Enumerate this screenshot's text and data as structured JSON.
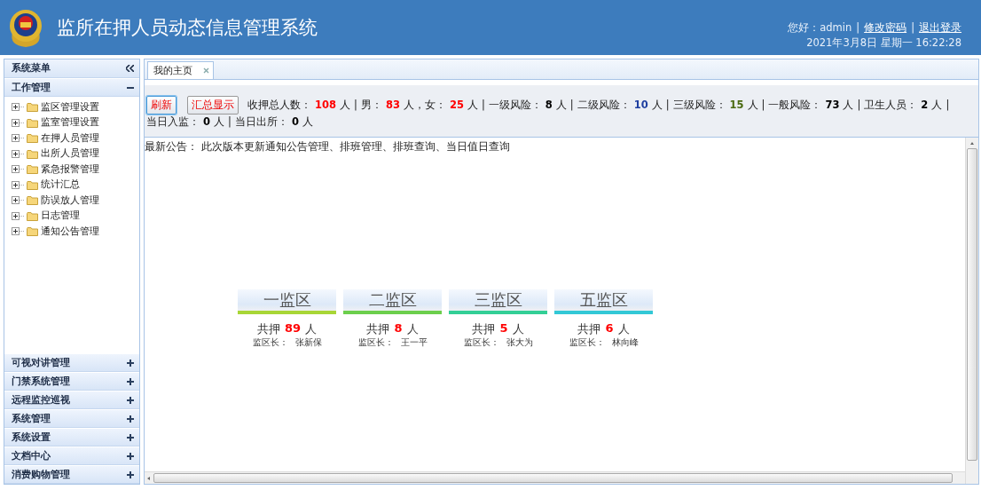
{
  "header": {
    "title": "监所在押人员动态信息管理系统",
    "user_bar": [
      {
        "kind": "text",
        "text": "您好：admin"
      },
      {
        "kind": "sep",
        "text": "|"
      },
      {
        "kind": "link",
        "text": "修改密码"
      },
      {
        "kind": "sep",
        "text": "|"
      },
      {
        "kind": "link",
        "text": "退出登录"
      }
    ],
    "datetime": "2021年3月8日 星期一 16:22:28"
  },
  "sidebar": {
    "title": "系统菜单",
    "sections": [
      {
        "title": "工作管理",
        "expanded": true,
        "items": [
          "监区管理设置",
          "监室管理设置",
          "在押人员管理",
          "出所人员管理",
          "紧急报警管理",
          "统计汇总",
          "防误放人管理",
          "日志管理",
          "通知公告管理"
        ]
      },
      {
        "title": "可视对讲管理",
        "expanded": false
      },
      {
        "title": "门禁系统管理",
        "expanded": false
      },
      {
        "title": "远程监控巡视",
        "expanded": false
      },
      {
        "title": "系统管理",
        "expanded": false
      },
      {
        "title": "系统设置",
        "expanded": false
      },
      {
        "title": "文档中心",
        "expanded": false
      },
      {
        "title": "消费购物管理",
        "expanded": false
      }
    ]
  },
  "tabs": [
    {
      "label": "我的主页",
      "selected": true
    }
  ],
  "toolbar": {
    "buttons": [
      {
        "label": "刷新",
        "kind": "primary"
      },
      {
        "label": "汇总显示",
        "kind": "plain"
      }
    ],
    "stats": [
      {
        "kind": "text",
        "text": "收押总人数："
      },
      {
        "kind": "value",
        "text": "108",
        "color": "#ff0000"
      },
      {
        "kind": "text",
        "text": "人"
      },
      {
        "kind": "sep",
        "text": "|"
      },
      {
        "kind": "text",
        "text": "男："
      },
      {
        "kind": "value",
        "text": "83",
        "color": "#ff0000"
      },
      {
        "kind": "text",
        "text": "人，女："
      },
      {
        "kind": "value",
        "text": "25",
        "color": "#ff0000"
      },
      {
        "kind": "text",
        "text": "人"
      },
      {
        "kind": "sep",
        "text": "|"
      },
      {
        "kind": "text",
        "text": "一级风险："
      },
      {
        "kind": "value",
        "text": "8",
        "color": "#000000"
      },
      {
        "kind": "text",
        "text": "人"
      },
      {
        "kind": "sep",
        "text": "|"
      },
      {
        "kind": "text",
        "text": "二级风险："
      },
      {
        "kind": "value",
        "text": "10",
        "color": "#1f3fa0"
      },
      {
        "kind": "text",
        "text": "人"
      },
      {
        "kind": "sep",
        "text": "|"
      },
      {
        "kind": "text",
        "text": "三级风险："
      },
      {
        "kind": "value",
        "text": "15",
        "color": "#4a6a10"
      },
      {
        "kind": "text",
        "text": "人"
      },
      {
        "kind": "sep",
        "text": "|"
      },
      {
        "kind": "text",
        "text": "一般风险："
      },
      {
        "kind": "value",
        "text": "73",
        "color": "#000000"
      },
      {
        "kind": "text",
        "text": "人"
      },
      {
        "kind": "sep",
        "text": "|"
      },
      {
        "kind": "text",
        "text": "卫生人员："
      },
      {
        "kind": "value",
        "text": "2",
        "color": "#000000"
      },
      {
        "kind": "text",
        "text": "人"
      },
      {
        "kind": "sep",
        "text": "|"
      },
      {
        "kind": "text",
        "text": "当日入监："
      },
      {
        "kind": "value",
        "text": "0",
        "color": "#000000"
      },
      {
        "kind": "text",
        "text": "人"
      },
      {
        "kind": "sep",
        "text": "|"
      },
      {
        "kind": "text",
        "text": "当日出所："
      },
      {
        "kind": "value",
        "text": "0",
        "color": "#000000"
      },
      {
        "kind": "text",
        "text": "人"
      }
    ]
  },
  "notice": "最新公告： 此次版本更新通知公告管理、排班管理、排班查询、当日值日查询",
  "areas": [
    {
      "name": "一监区",
      "color": "#a8d636",
      "count_label": "共押",
      "count": "89",
      "count_unit": "人",
      "leader_label": "监区长：",
      "leader": "张新保"
    },
    {
      "name": "二监区",
      "color": "#6ccf4c",
      "count_label": "共押",
      "count": "8",
      "count_unit": "人",
      "leader_label": "监区长：",
      "leader": "王一平"
    },
    {
      "name": "三监区",
      "color": "#33cf96",
      "count_label": "共押",
      "count": "5",
      "count_unit": "人",
      "leader_label": "监区长：",
      "leader": "张大为"
    },
    {
      "name": "五监区",
      "color": "#33c8d6",
      "count_label": "共押",
      "count": "6",
      "count_unit": "人",
      "leader_label": "监区长：",
      "leader": "林向峰"
    }
  ]
}
